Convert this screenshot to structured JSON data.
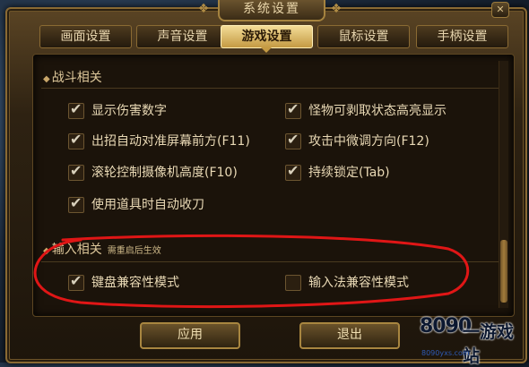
{
  "window": {
    "title": "系统设置",
    "close_label": "✕"
  },
  "tabs": [
    {
      "label": "画面设置",
      "active": false
    },
    {
      "label": "声音设置",
      "active": false
    },
    {
      "label": "游戏设置",
      "active": true
    },
    {
      "label": "鼠标设置",
      "active": false
    },
    {
      "label": "手柄设置",
      "active": false
    }
  ],
  "combat": {
    "title": "战斗相关",
    "options": [
      {
        "label": "显示伤害数字",
        "checked": true
      },
      {
        "label": "怪物可剥取状态高亮显示",
        "checked": true
      },
      {
        "label": "出招自动对准屏幕前方(F11)",
        "checked": true
      },
      {
        "label": "攻击中微调方向(F12)",
        "checked": true
      },
      {
        "label": "滚轮控制摄像机高度(F10)",
        "checked": true
      },
      {
        "label": "持续锁定(Tab)",
        "checked": true
      },
      {
        "label": "使用道具时自动收刀",
        "checked": true
      }
    ]
  },
  "input": {
    "title": "输入相关",
    "note": "需重启后生效",
    "options": [
      {
        "label": "键盘兼容性模式",
        "checked": true
      },
      {
        "label": "输入法兼容性模式",
        "checked": false
      }
    ]
  },
  "buttons": {
    "apply": "应用",
    "exit": "退出"
  },
  "watermark": {
    "logo": "8090",
    "name": "一游戏站",
    "url": "8090yxs.com"
  },
  "colors": {
    "accent_gold": "#c49a43",
    "annotation_red": "#e01616"
  }
}
